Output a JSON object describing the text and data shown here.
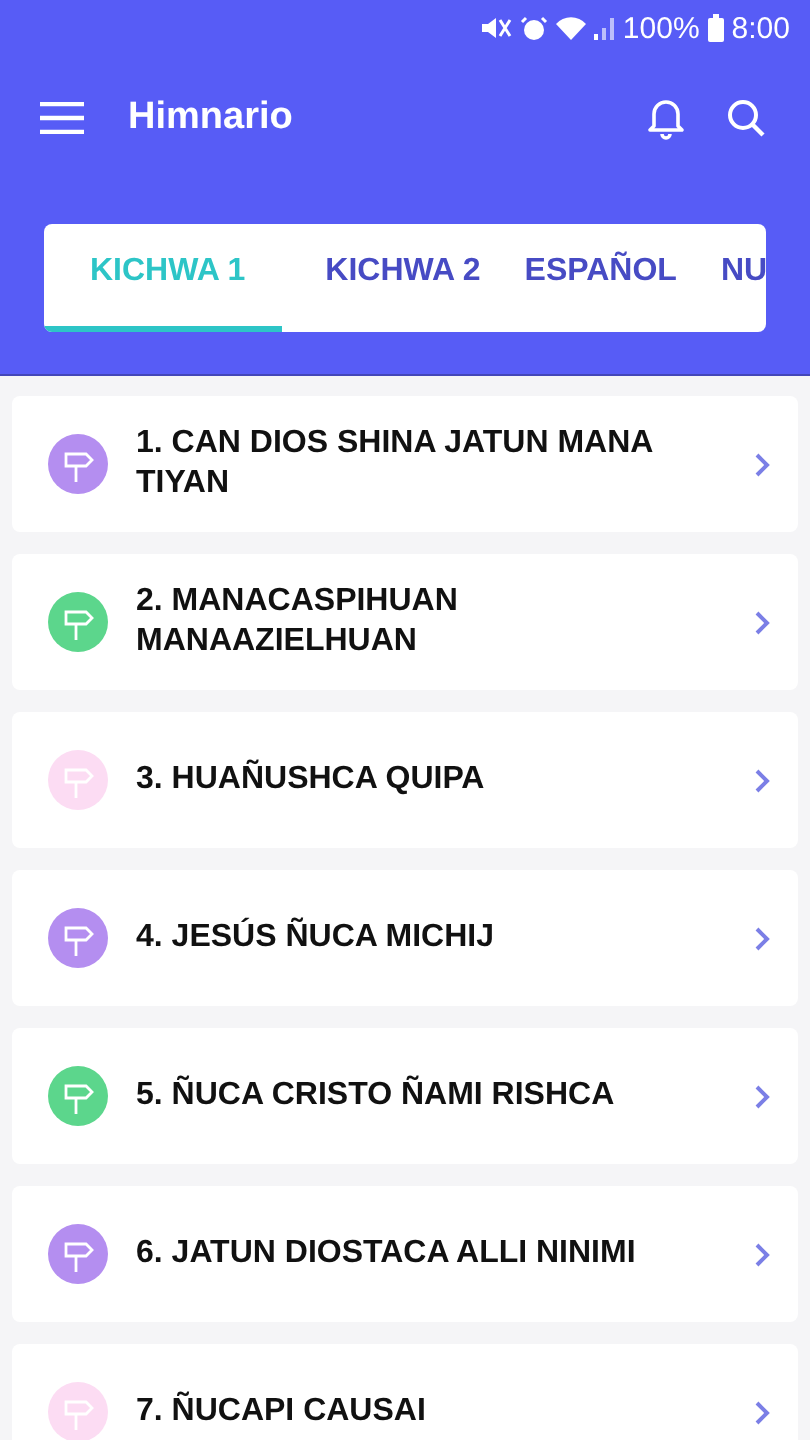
{
  "status_bar": {
    "battery": "100%",
    "time": "8:00"
  },
  "app_bar": {
    "title": "Himnario"
  },
  "tabs": [
    {
      "label": "KICHWA 1",
      "selected": true
    },
    {
      "label": "KICHWA 2",
      "selected": false
    },
    {
      "label": "ESPAÑOL",
      "selected": false
    },
    {
      "label": "NU",
      "selected": false
    }
  ],
  "hymns": [
    {
      "title": "1. CAN DIOS SHINA JATUN MANA TIYAN",
      "color": "#b48ef0"
    },
    {
      "title": "2. MANACASPIHUAN MANAAZIELHUAN",
      "color": "#5cd68c"
    },
    {
      "title": "3. HUAÑUSHCA QUIPA",
      "color": "#fcdcf3"
    },
    {
      "title": "4. JESÚS ÑUCA MICHIJ",
      "color": "#b48ef0"
    },
    {
      "title": "5. ÑUCA CRISTO ÑAMI RISHCA",
      "color": "#5cd68c"
    },
    {
      "title": "6. JATUN DIOSTACA ALLI NINIMI",
      "color": "#b48ef0"
    },
    {
      "title": "7. ÑUCAPI CAUSAI",
      "color": "#fcdcf3"
    }
  ]
}
